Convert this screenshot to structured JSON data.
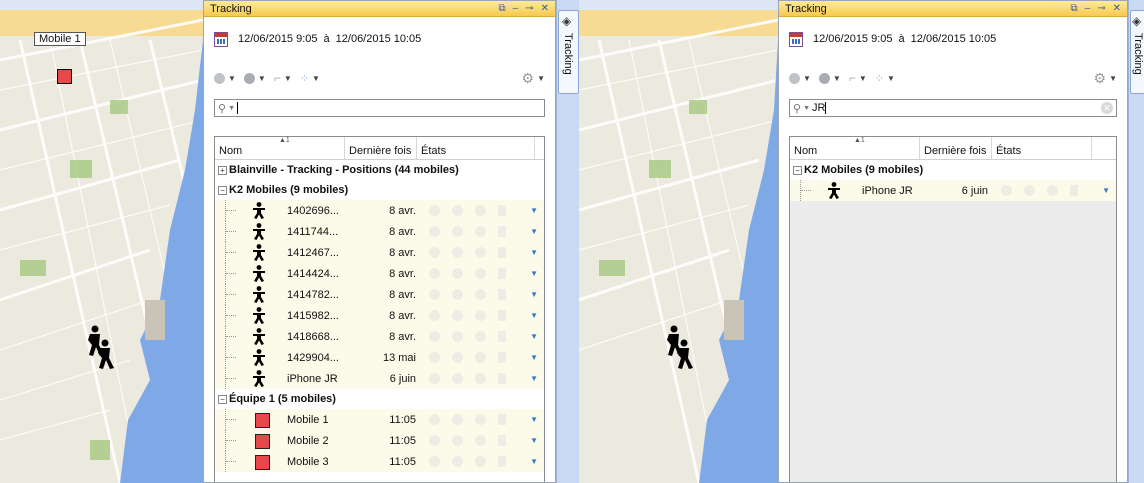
{
  "left_panel": {
    "map_label": "Mobile 1",
    "title": "Tracking",
    "date_from": "12/06/2015  9:05",
    "date_sep": "à",
    "date_to": "12/06/2015  10:05",
    "search_value": "",
    "columns": [
      "Nom",
      "Dernière fois",
      "États"
    ],
    "sort_indicator": "▲1",
    "groups": [
      {
        "label": "Blainville - Tracking - Positions (44 mobiles)",
        "expanded": false
      },
      {
        "label": "K2 Mobiles (9 mobiles)",
        "expanded": true
      },
      {
        "label": "Équipe 1 (5 mobiles)",
        "expanded": true
      }
    ],
    "k2_rows": [
      {
        "name": "1402696...",
        "time": "8 avr."
      },
      {
        "name": "1411744...",
        "time": "8 avr."
      },
      {
        "name": "1412467...",
        "time": "8 avr."
      },
      {
        "name": "1414424...",
        "time": "8 avr."
      },
      {
        "name": "1414782...",
        "time": "8 avr."
      },
      {
        "name": "1415982...",
        "time": "8 avr."
      },
      {
        "name": "1418668...",
        "time": "8 avr."
      },
      {
        "name": "1429904...",
        "time": "13 mai"
      },
      {
        "name": "iPhone JR",
        "time": "6 juin"
      }
    ],
    "equipe_rows": [
      {
        "name": "Mobile 1",
        "time": "11:05"
      },
      {
        "name": "Mobile 2",
        "time": "11:05"
      },
      {
        "name": "Mobile 3",
        "time": "11:05"
      }
    ],
    "side_tab": "Tracking"
  },
  "right_panel": {
    "title": "Tracking",
    "date_from": "12/06/2015  9:05",
    "date_sep": "à",
    "date_to": "12/06/2015  10:05",
    "search_value": "JR",
    "columns": [
      "Nom",
      "Dernière fois",
      "États"
    ],
    "sort_indicator": "▲1",
    "groups": [
      {
        "label": "K2 Mobiles (9 mobiles)",
        "expanded": true
      }
    ],
    "rows": [
      {
        "name": "iPhone JR",
        "time": "6 juin"
      }
    ],
    "side_tab": "Tracking"
  },
  "colors": {
    "title_bar": "#f7c94e",
    "mobile_marker": "#e8474b",
    "water": "#7fa9e6",
    "map_bg": "#eceadf"
  }
}
